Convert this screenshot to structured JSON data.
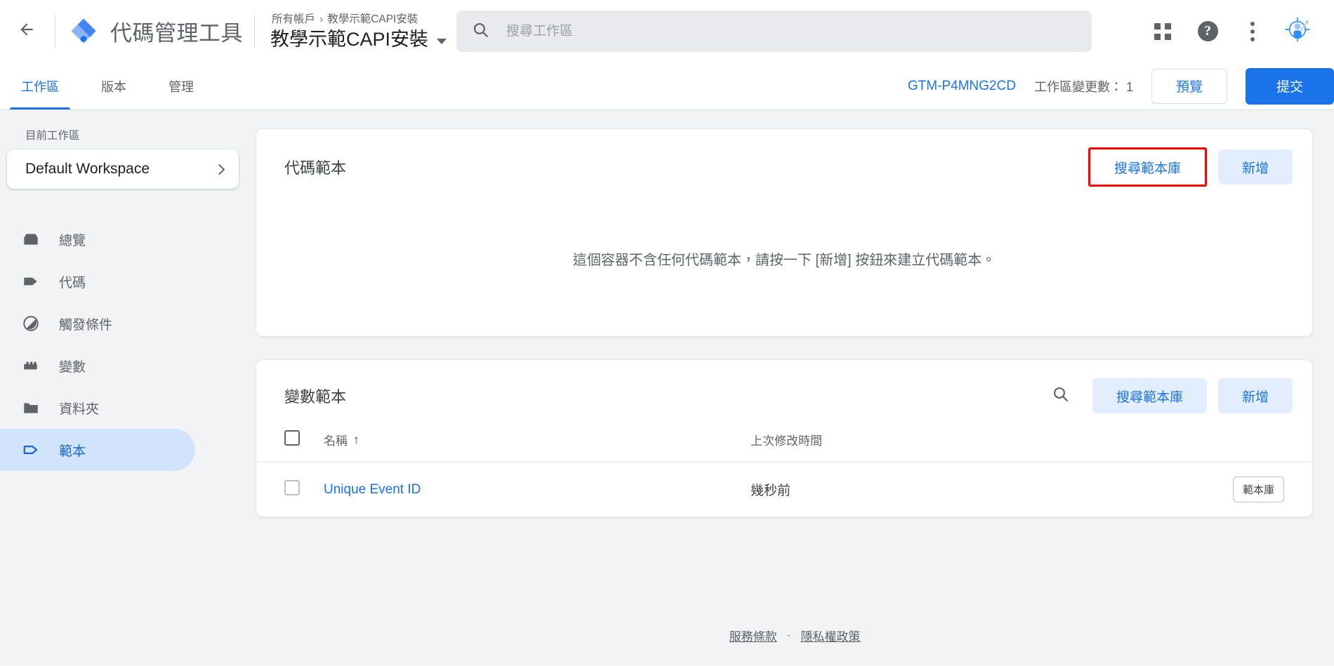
{
  "header": {
    "back_icon": "arrow-back-icon",
    "logo_icon": "gtm-logo-icon",
    "product_title": "代碼管理工具",
    "breadcrumb_root": "所有帳戶",
    "breadcrumb_sep": "›",
    "breadcrumb_current": "教學示範CAPI安裝",
    "container_name": "教學示範CAPI安裝",
    "search": {
      "icon": "search-icon",
      "placeholder": "搜尋工作區",
      "value": ""
    },
    "actions": {
      "apps_label": "apps-grid-icon",
      "help_label": "?",
      "menu_label": "more-vert-icon",
      "avatar_label": "account-avatar-icon"
    }
  },
  "tabbar": {
    "tabs": [
      {
        "label": "工作區",
        "active": true
      },
      {
        "label": "版本",
        "active": false
      },
      {
        "label": "管理",
        "active": false
      }
    ],
    "container_id": "GTM-P4MNG2CD",
    "changes_text": "工作區變更數： 1",
    "preview_label": "預覽",
    "submit_label": "提交"
  },
  "sidebar": {
    "current_workspace_label": "目前工作區",
    "workspace_name": "Default Workspace",
    "chevron_icon": "chevron-right-icon",
    "items": [
      {
        "label": "總覽",
        "icon": "overview-icon",
        "active": false
      },
      {
        "label": "代碼",
        "icon": "tag-icon",
        "active": false
      },
      {
        "label": "觸發條件",
        "icon": "trigger-icon",
        "active": false
      },
      {
        "label": "變數",
        "icon": "variable-icon",
        "active": false
      },
      {
        "label": "資料夾",
        "icon": "folder-icon",
        "active": false
      },
      {
        "label": "範本",
        "icon": "template-icon",
        "active": true
      }
    ]
  },
  "main": {
    "tag_templates_card": {
      "title": "代碼範本",
      "gallery_button": "搜尋範本庫",
      "gallery_highlighted": true,
      "new_button": "新增",
      "empty_message": "這個容器不含任何代碼範本，請按一下 [新增] 按鈕來建立代碼範本。"
    },
    "variable_templates_card": {
      "title": "變數範本",
      "search_icon": "search-icon",
      "gallery_button": "搜尋範本庫",
      "new_button": "新增",
      "columns": {
        "name": "名稱",
        "sort_arrow": "↑",
        "last_modified": "上次修改時間"
      },
      "rows": [
        {
          "name": "Unique Event ID",
          "last_modified": "幾秒前",
          "badge": "範本庫"
        }
      ]
    }
  },
  "footer": {
    "terms": "服務條款",
    "separator": "·",
    "privacy": "隱私權政策"
  },
  "colors": {
    "accent": "#1a73e8",
    "tonal": "#e2eefd",
    "sidebar_bg": "#f1f3f4",
    "active_nav": "#d2e3fc",
    "highlight": "#ff0000"
  }
}
